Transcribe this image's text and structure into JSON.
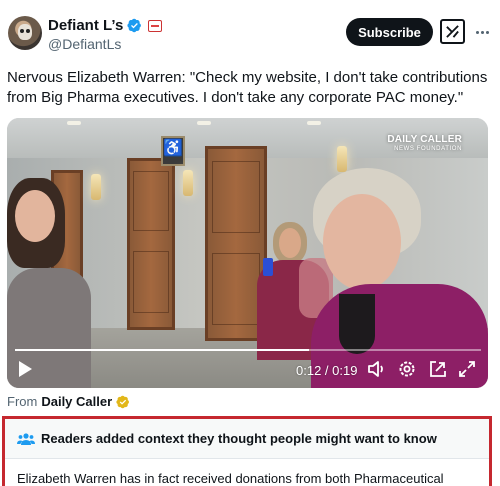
{
  "post": {
    "author": {
      "display_name": "Defiant L’s",
      "handle": "@DefiantLs",
      "avatar_icon": "skull-avatar",
      "verified_icon": "blue-verified-badge-icon",
      "affiliate_badge_icon": "affiliate-badge-icon"
    },
    "subscribe_label": "Subscribe",
    "grok_icon": "grok-icon",
    "more_icon": "more-options-icon",
    "text": "Nervous Elizabeth Warren: \"Check my website, I don't take contributions from Big Pharma executives. I don't take any corporate PAC money.\""
  },
  "video": {
    "watermark_line1": "DAILY CALLER",
    "watermark_line2": "NEWS FOUNDATION",
    "time": "0:12 / 0:19",
    "progress": 0.63,
    "controls": [
      "play-icon",
      "volume-icon",
      "settings-icon",
      "picture-in-picture-icon",
      "fullscreen-icon"
    ]
  },
  "source": {
    "prefix": "From",
    "name": "Daily Caller",
    "badge_icon": "gold-verified-badge-icon"
  },
  "community_note": {
    "title": "Readers added context they thought people might want to know",
    "body": "Elizabeth Warren has in fact received donations from both Pharmaceutical",
    "icon": "people-icon"
  },
  "colors": {
    "accent": "#1d9bf0",
    "note_border": "#c5282f",
    "text": "#0f1419",
    "muted": "#536471"
  }
}
